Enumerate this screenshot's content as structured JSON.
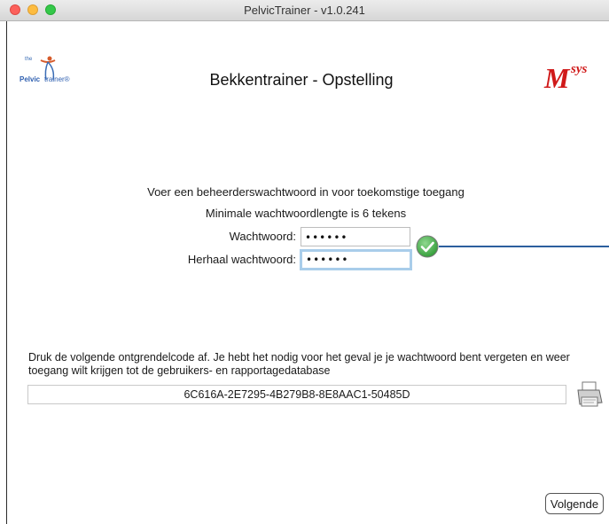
{
  "window": {
    "title": "PelvicTrainer - v1.0.241"
  },
  "header": {
    "logo_the": "the",
    "logo_pelvic": "Pelvic",
    "logo_trainer": "trainer®",
    "page_title": "Bekkentrainer - Opstelling",
    "brand_m": "M",
    "brand_sys": "sys"
  },
  "form": {
    "instruction": "Voer een beheerderswachtwoord in voor toekomstige toegang",
    "min_length_note": "Minimale wachtwoordlengte is 6 tekens",
    "password_label": "Wachtwoord:",
    "password_value": "••••••",
    "repeat_label": "Herhaal wachtwoord:",
    "repeat_value": "••••••",
    "match_icon": "check-circle-icon"
  },
  "unlock": {
    "description": "Druk de volgende ontgrendelcode af. Je hebt het nodig voor het geval je je wachtwoord bent vergeten en weer toegang wilt krijgen tot de gebruikers- en rapportagedatabase",
    "code": "6C616A-2E7295-4B279B8-8E8AAC1-50485D",
    "print_icon": "printer-icon"
  },
  "footer": {
    "next_label": "Volgende"
  },
  "colors": {
    "brand_red": "#d01a1a",
    "logo_blue": "#2e5fb0",
    "focus_ring": "#a9cdea",
    "check_green": "#3fae3f",
    "connector_blue": "#2c5f9e"
  }
}
